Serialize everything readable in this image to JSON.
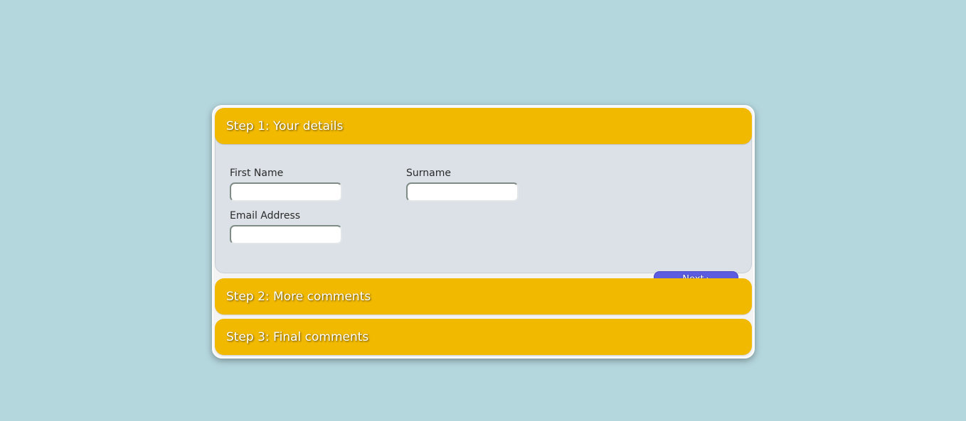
{
  "steps": [
    {
      "title": "Step 1: Your details"
    },
    {
      "title": "Step 2: More comments"
    },
    {
      "title": "Step 3: Final comments"
    }
  ],
  "form": {
    "first_name_label": "First Name",
    "first_name_value": "",
    "surname_label": "Surname",
    "surname_value": "",
    "email_label": "Email Address",
    "email_value": "",
    "next_label": "Next",
    "next_icon": "chevron-right-icon"
  },
  "colors": {
    "background": "#b4d7dd",
    "step_header": "#f1b900",
    "panel": "#dbe1e7",
    "next_button": "#5c5ce0"
  }
}
